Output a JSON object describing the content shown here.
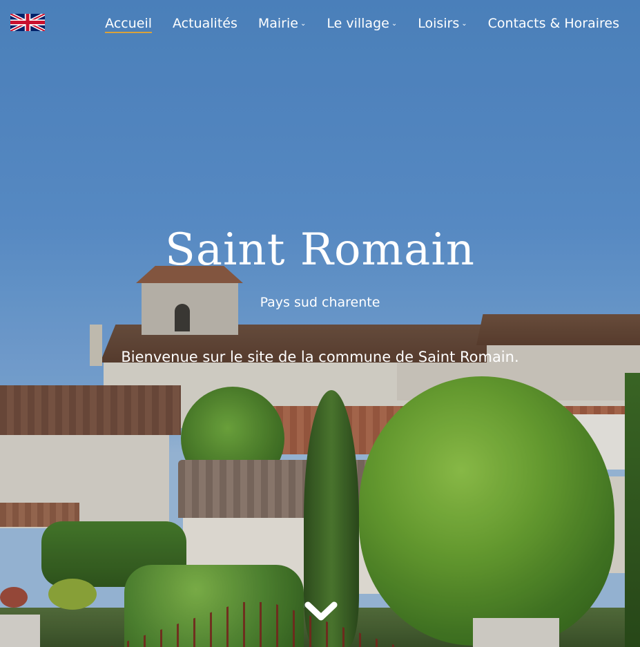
{
  "nav": {
    "language_flag_alt": "English",
    "items": [
      {
        "label": "Accueil",
        "active": true,
        "dropdown": false
      },
      {
        "label": "Actualités",
        "active": false,
        "dropdown": false
      },
      {
        "label": "Mairie",
        "active": false,
        "dropdown": true
      },
      {
        "label": "Le village",
        "active": false,
        "dropdown": true
      },
      {
        "label": "Loisirs",
        "active": false,
        "dropdown": true
      },
      {
        "label": "Contacts & Horaires",
        "active": false,
        "dropdown": false
      }
    ]
  },
  "hero": {
    "title": "Saint Romain",
    "subtitle": "Pays sud charente",
    "welcome": "Bienvenue sur le site de la commune de Saint Romain."
  },
  "icons": {
    "language": "uk-flag-icon",
    "scroll": "chevron-down-icon",
    "dropdown": "caret-down-icon"
  },
  "colors": {
    "active_underline": "#d9a23a",
    "text": "#ffffff",
    "sky": "#5b91cd"
  }
}
